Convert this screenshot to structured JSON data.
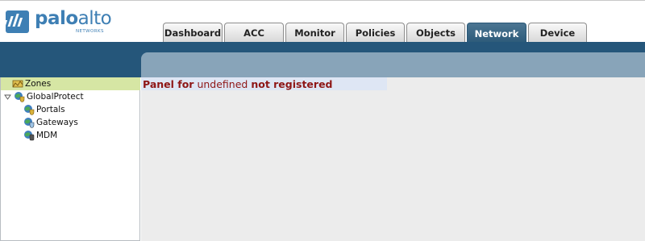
{
  "brand": {
    "word_bold": "palo",
    "word_light": "alto",
    "subtitle": "NETWORKS",
    "color": "#3e7fb4"
  },
  "tabs": [
    {
      "label": "Dashboard",
      "active": false
    },
    {
      "label": "ACC",
      "active": false
    },
    {
      "label": "Monitor",
      "active": false
    },
    {
      "label": "Policies",
      "active": false
    },
    {
      "label": "Objects",
      "active": false
    },
    {
      "label": "Network",
      "active": true
    },
    {
      "label": "Device",
      "active": false
    }
  ],
  "tree": {
    "items": [
      {
        "label": "Zones",
        "icon": "zones-icon",
        "selected": true
      },
      {
        "label": "GlobalProtect",
        "icon": "globe-shield-icon",
        "expanded": true
      },
      {
        "label": "Portals",
        "icon": "globe-shield-icon"
      },
      {
        "label": "Gateways",
        "icon": "globe-shield-icon"
      },
      {
        "label": "MDM",
        "icon": "globe-shield-icon"
      }
    ]
  },
  "panel": {
    "part1": "Panel for",
    "part2": "undefined",
    "part3": "not registered"
  },
  "colors": {
    "navbar": "#25567a",
    "navbar_inner": "#88a4b9",
    "selected_row": "#d6e6a4",
    "message": "#8e1616"
  }
}
